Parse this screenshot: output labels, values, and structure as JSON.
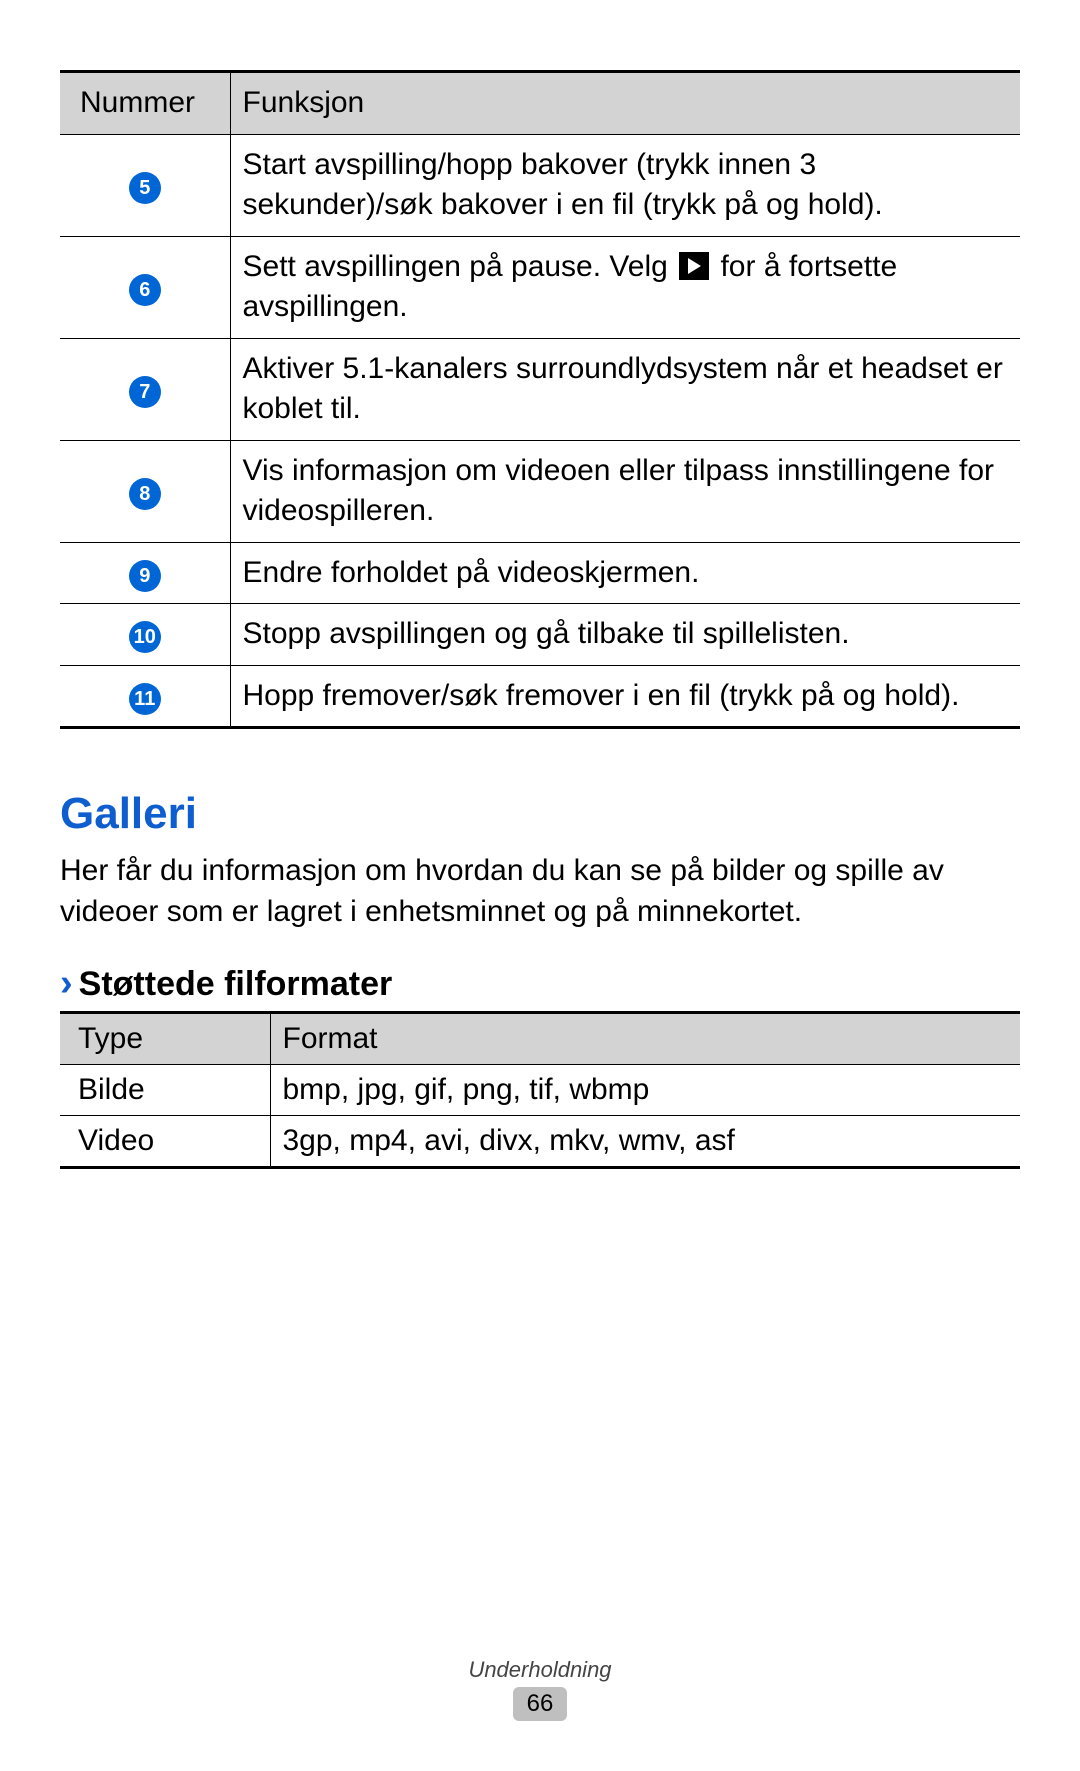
{
  "func_table": {
    "headers": {
      "col1": "Nummer",
      "col2": "Funksjon"
    },
    "rows": [
      {
        "num": "5",
        "desc": "Start avspilling/hopp bakover (trykk innen 3 sekunder)/søk bakover i en fil (trykk på og hold)."
      },
      {
        "num": "6",
        "desc_before": "Sett avspillingen på pause. Velg ",
        "desc_after": " for å fortsette avspillingen."
      },
      {
        "num": "7",
        "desc": "Aktiver 5.1-kanalers surroundlydsystem når et headset er koblet til."
      },
      {
        "num": "8",
        "desc": "Vis informasjon om videoen eller tilpass innstillingene for videospilleren."
      },
      {
        "num": "9",
        "desc": "Endre forholdet på videoskjermen."
      },
      {
        "num": "10",
        "desc": "Stopp avspillingen og gå tilbake til spillelisten."
      },
      {
        "num": "11",
        "desc": "Hopp fremover/søk fremover i en fil (trykk på og hold)."
      }
    ]
  },
  "section_title": "Galleri",
  "section_body": "Her får du informasjon om hvordan du kan se på bilder og spille av videoer som er lagret i enhetsminnet og på minnekortet.",
  "subheading": "Støttede filformater",
  "fmt_table": {
    "headers": {
      "c1": "Type",
      "c2": "Format"
    },
    "rows": [
      {
        "type": "Bilde",
        "format": "bmp, jpg, gif, png, tif, wbmp"
      },
      {
        "type": "Video",
        "format": "3gp, mp4, avi, divx, mkv, wmv, asf"
      }
    ]
  },
  "footer": {
    "chapter": "Underholdning",
    "page": "66"
  }
}
